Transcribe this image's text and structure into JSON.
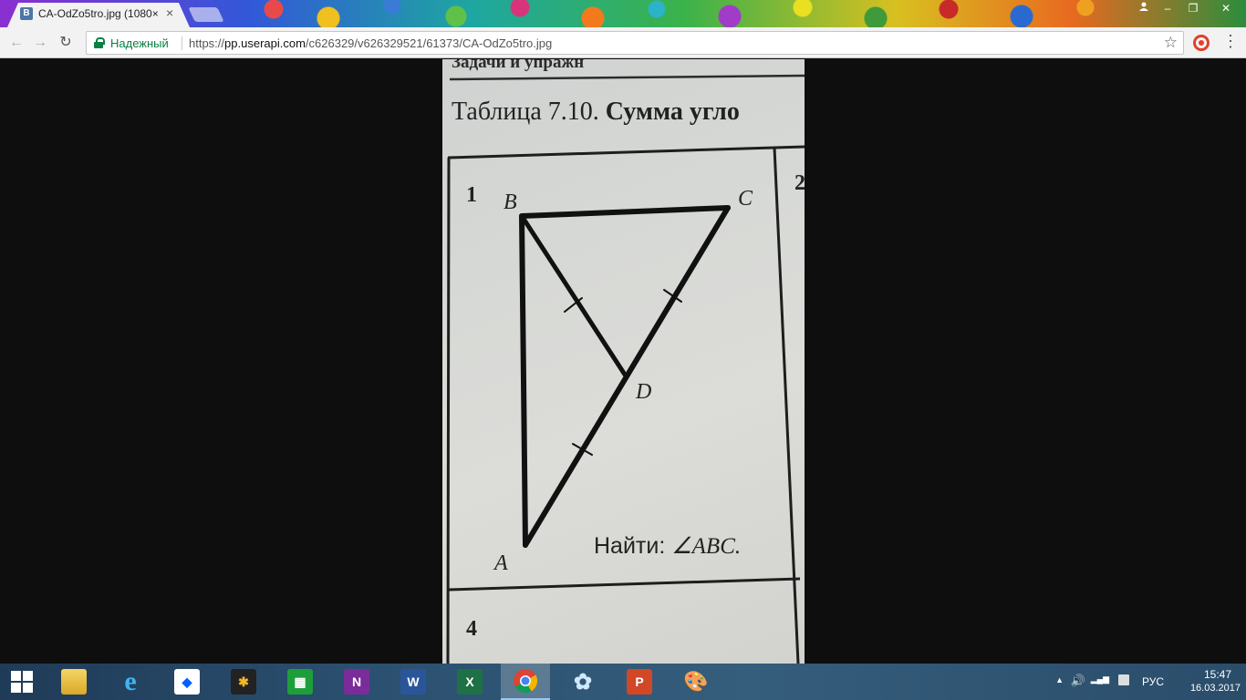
{
  "browser": {
    "tab": {
      "favicon": "B",
      "title": "CA-OdZo5tro.jpg (1080×",
      "close": "×"
    },
    "window_controls": {
      "user": "user-icon",
      "minimize": "–",
      "restore": "❐",
      "close": "✕"
    },
    "nav": {
      "back": "←",
      "forward": "→",
      "reload": "↻"
    },
    "omnibox": {
      "secure_label": "Надежный",
      "url_scheme": "https://",
      "url_host": "pp.userapi.com",
      "url_path": "/c626329/v626329521/61373/CA-OdZo5tro.jpg",
      "bookmark": "☆"
    },
    "menu": "⋮"
  },
  "photo": {
    "header_cut": "Задачи и упражн",
    "table_caption_normal": "Таблица 7.10. ",
    "table_caption_bold": "Сумма угло",
    "cell1_number": "1",
    "cell2_number": "2",
    "cell4_number": "4",
    "labels": {
      "B": "B",
      "C": "C",
      "D": "D",
      "A": "A"
    },
    "task_word": "Найти: ",
    "task_target": "∠ABC."
  },
  "taskbar": {
    "apps": [
      {
        "name": "explorer",
        "glyph": ""
      },
      {
        "name": "internet-explorer",
        "glyph": "e"
      },
      {
        "name": "dropbox",
        "glyph": "◆"
      },
      {
        "name": "paint-app",
        "glyph": "✱"
      },
      {
        "name": "store",
        "glyph": "▦"
      },
      {
        "name": "onenote",
        "glyph": "N"
      },
      {
        "name": "word",
        "glyph": "W"
      },
      {
        "name": "excel",
        "glyph": "X"
      },
      {
        "name": "chrome",
        "glyph": ""
      },
      {
        "name": "flower-app",
        "glyph": "✿"
      },
      {
        "name": "powerpoint",
        "glyph": "P"
      },
      {
        "name": "paint",
        "glyph": "🎨"
      }
    ],
    "tray": {
      "chevron": "▲",
      "volume": "🔊",
      "network": "▂▄▆",
      "language": "РУС",
      "time": "15:47",
      "date": "16.03.2017"
    }
  }
}
